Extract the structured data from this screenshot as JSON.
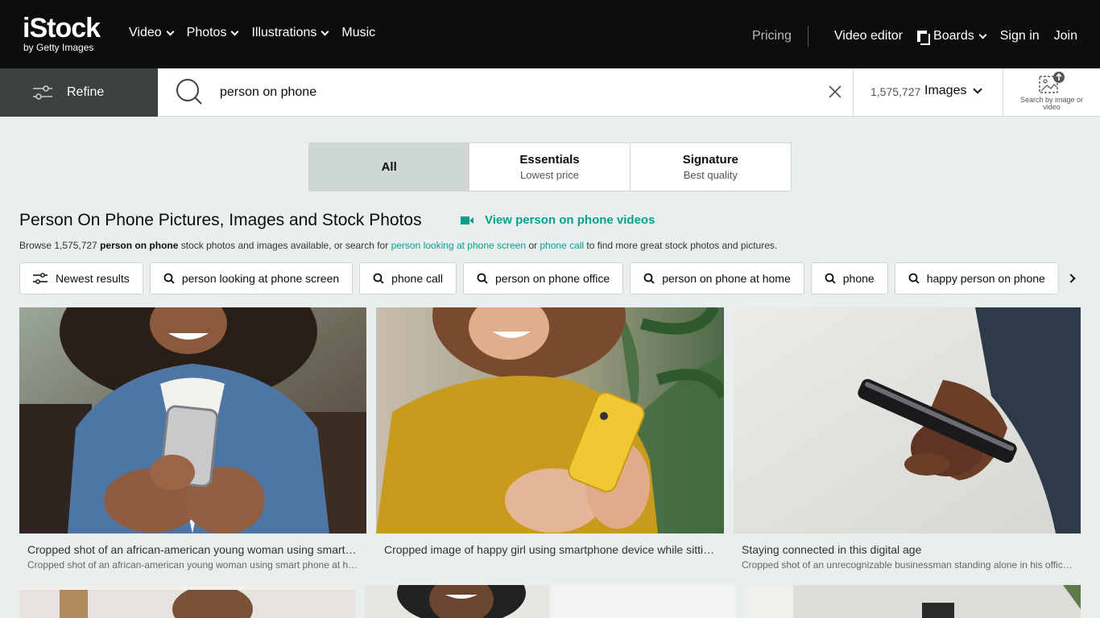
{
  "brand": {
    "logo_main": "iStock",
    "logo_sub": "by Getty Images"
  },
  "nav": {
    "left": [
      {
        "label": "Video",
        "dropdown": true
      },
      {
        "label": "Photos",
        "dropdown": true
      },
      {
        "label": "Illustrations",
        "dropdown": true
      },
      {
        "label": "Music",
        "dropdown": false
      }
    ],
    "pricing": "Pricing",
    "video_editor": "Video editor",
    "boards": "Boards",
    "sign_in": "Sign in",
    "join": "Join"
  },
  "search": {
    "refine_label": "Refine",
    "query": "person on phone",
    "result_count": "1,575,727",
    "media_type": "Images",
    "search_by_image_label": "Search by image or video"
  },
  "tabs": [
    {
      "title": "All",
      "subtitle": "",
      "active": true
    },
    {
      "title": "Essentials",
      "subtitle": "Lowest price",
      "active": false
    },
    {
      "title": "Signature",
      "subtitle": "Best quality",
      "active": false
    }
  ],
  "heading": {
    "title": "Person On Phone Pictures, Images and Stock Photos",
    "video_link": "View person on phone videos",
    "browse_prefix": "Browse 1,575,727 ",
    "browse_bold": "person on phone",
    "browse_mid": " stock photos and images available, or search for ",
    "browse_link1": "person looking at phone screen",
    "browse_or": " or ",
    "browse_link2": "phone call",
    "browse_suffix": " to find more great stock photos and pictures."
  },
  "chips": [
    {
      "label": "Newest results",
      "icon": "sliders-icon"
    },
    {
      "label": "person looking at phone screen",
      "icon": "search-icon"
    },
    {
      "label": "phone call",
      "icon": "search-icon"
    },
    {
      "label": "person on phone office",
      "icon": "search-icon"
    },
    {
      "label": "person on phone at home",
      "icon": "search-icon"
    },
    {
      "label": "phone",
      "icon": "search-icon"
    },
    {
      "label": "happy person on phone",
      "icon": "search-icon"
    }
  ],
  "results": [
    {
      "title": "Cropped shot of an african-american young woman using smart phone at home",
      "description": "Cropped shot of an african-american young woman using smart phone at home. Smiling african american woman using smartphone at home"
    },
    {
      "title": "Cropped image of happy girl using smartphone device while sitting in cafe",
      "description": ""
    },
    {
      "title": "Staying connected in this digital age",
      "description": "Cropped shot of an unrecognizable businessman standing alone in his office and texting on his cellphone"
    }
  ],
  "colors": {
    "accent": "#08a08a",
    "topbar": "#0c0d0d",
    "refine_bg": "#3e4141",
    "page_bg": "#e9eeee"
  }
}
